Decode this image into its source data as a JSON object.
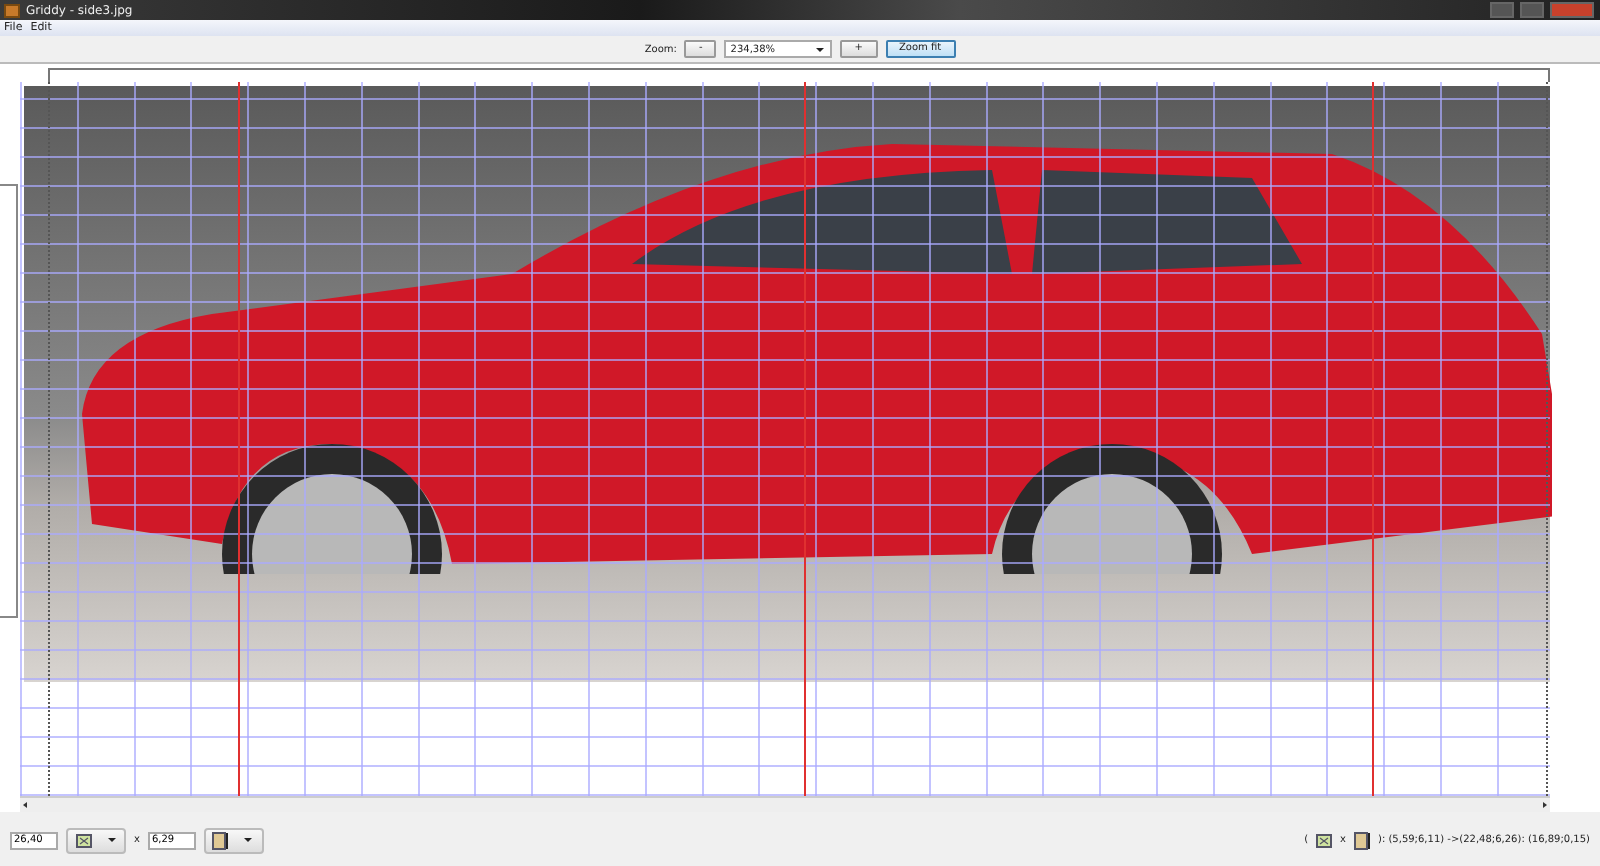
{
  "window": {
    "title": "Griddy - side3.jpg"
  },
  "menu": [
    {
      "label": "File"
    },
    {
      "label": "Edit"
    }
  ],
  "toolbar": {
    "zoom_label": "Zoom:",
    "zoom_out": "-",
    "zoom_value": "234,38%",
    "zoom_in": "+",
    "zoom_fit": "Zoom fit"
  },
  "bottom_bar": {
    "width_value": "26,40",
    "separator": "x",
    "height_value": "6,29",
    "status_open": "(",
    "status_times": "x",
    "status_text": "): (5,59;6,11) ->(22,48;6,26): (16,89;0,15)"
  }
}
